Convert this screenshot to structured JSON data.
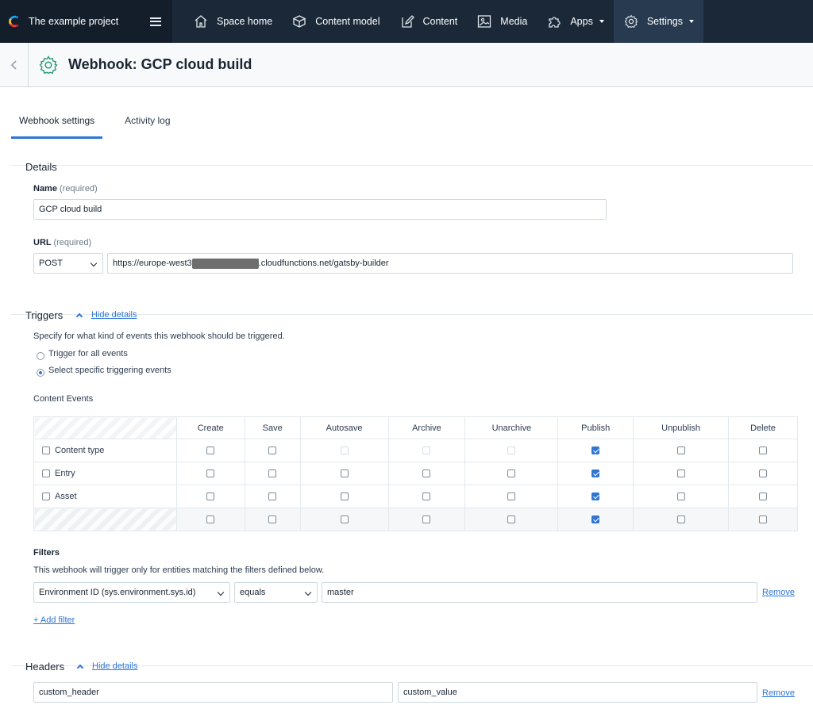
{
  "topbar": {
    "project_name": "The example project",
    "nav": [
      {
        "label": "Space home",
        "icon": "home-icon"
      },
      {
        "label": "Content model",
        "icon": "box-icon"
      },
      {
        "label": "Content",
        "icon": "edit-icon"
      },
      {
        "label": "Media",
        "icon": "image-icon"
      },
      {
        "label": "Apps",
        "icon": "puzzle-icon"
      },
      {
        "label": "Settings",
        "icon": "gear-icon"
      }
    ]
  },
  "page": {
    "title": "Webhook: GCP cloud build"
  },
  "tabs": [
    "Webhook settings",
    "Activity log"
  ],
  "details": {
    "title": "Details",
    "name_label": "Name",
    "name_req": "(required)",
    "name_value": "GCP cloud build",
    "url_label": "URL",
    "url_req": "(required)",
    "method": "POST",
    "url_prefix": "https://europe-west3",
    "url_suffix": ".cloudfunctions.net/gatsby-builder"
  },
  "triggers": {
    "title": "Triggers",
    "hide": "Hide details",
    "desc": "Specify for what kind of events this webhook should be triggered.",
    "opt_all": "Trigger for all events",
    "opt_specific": "Select specific triggering events",
    "content_events_label": "Content Events",
    "columns": [
      "Create",
      "Save",
      "Autosave",
      "Archive",
      "Unarchive",
      "Publish",
      "Unpublish",
      "Delete"
    ],
    "rows": [
      "Content type",
      "Entry",
      "Asset"
    ],
    "checked_column": "Publish"
  },
  "filters": {
    "title": "Filters",
    "desc": "This webhook will trigger only for entities matching the filters defined below.",
    "field": "Environment ID (sys.environment.sys.id)",
    "operator": "equals",
    "value": "master",
    "remove": "Remove",
    "add": "+ Add filter"
  },
  "headers": {
    "title": "Headers",
    "hide": "Hide details",
    "key": "custom_header",
    "value": "custom_value",
    "remove": "Remove"
  }
}
